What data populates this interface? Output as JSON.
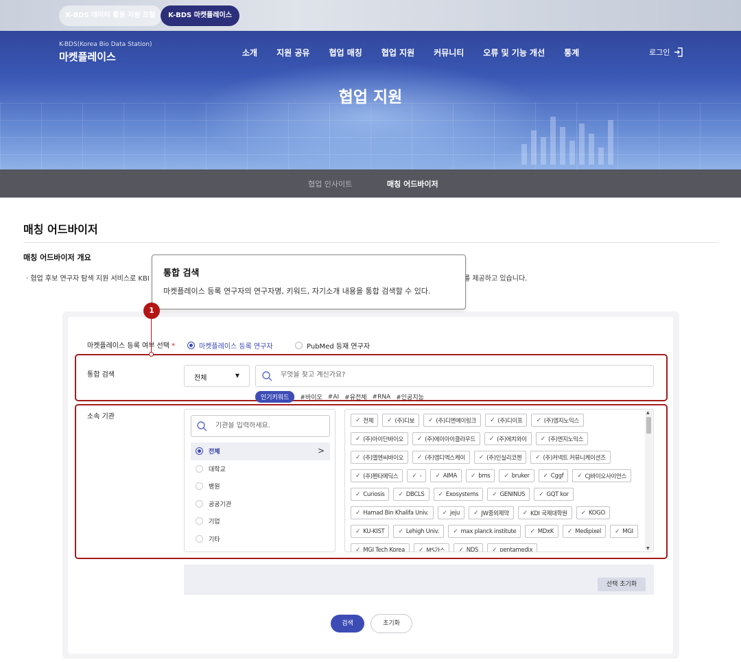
{
  "top_tabs": [
    "K-BDS 데이터 활용 지원 포털",
    "K-BDS 마켓플레이스"
  ],
  "brand": {
    "sub": "K-BDS(Korea Bio Data Station)",
    "main": "마켓플레이스"
  },
  "gnb": [
    "소개",
    "지원 공유",
    "협업 매칭",
    "협업 지원",
    "커뮤니티",
    "오류 및 기능 개선",
    "통계"
  ],
  "login_label": "로그인",
  "hero_title": "협업 지원",
  "subnav": [
    "협업 인사이트",
    "매칭 어드바이저"
  ],
  "page_title": "매칭 어드바이저",
  "section_title": "매칭 어드바이저 개요",
  "desc_left": "· 협업 후보 연구자 탐색 지원 서비스로 KBI",
  "desc_right": "를 제공하고 있습니다.",
  "tooltip": {
    "title": "통합 검색",
    "body": "마켓플레이스 등록 연구자의 연구자명, 키워드, 자기소개 내용을 통합 검색할 수 있다."
  },
  "marker_number": "1",
  "form": {
    "register_label": "마켓플레이스 등록 여부 선택",
    "required_mark": "*",
    "radio_options": [
      "마켓플레이스 등록 연구자",
      "PubMed 등재 연구자"
    ],
    "search_label": "통합 검색",
    "select_value": "전체",
    "search_placeholder": "무엇을 찾고 계신가요?",
    "popular_badge": "인기키워드",
    "keywords": [
      "#바이오",
      "#AI",
      "#유전체",
      "#RNA",
      "#인공지능"
    ],
    "org_label": "소속 기관",
    "org_placeholder": "기관을 입력하세요.",
    "org_types": [
      "전체",
      "대학교",
      "병원",
      "공공기관",
      "기업",
      "기타"
    ],
    "chips": [
      "전체",
      "(주)디보",
      "(주)디엔에이링크",
      "(주)디이프",
      "(주)엠지노믹스",
      "(주)아이단바이오",
      "(주)에이아이클라우드",
      "(주)에치와이",
      "(주)엔지노믹스",
      "(주)엘엔씨바이오",
      "(주)엠디엑스케이",
      "(주)인실리코젠",
      "(주)커넥트 커뮤니케이션즈",
      "(주)펜타메딕스",
      "-",
      "AIMA",
      "bms",
      "bruker",
      "Cggf",
      "CJ바이오사이언스",
      "Curiosis",
      "DBCLS",
      "Exosystems",
      "GENINUS",
      "GQT kor",
      "Hamad Bin Khalifa Univ.",
      "jeju",
      "JW중외제약",
      "KDI 국제대학원",
      "KOGO",
      "KU-KIST",
      "Lehigh Univ.",
      "max planck institute",
      "MDxK",
      "Medipixel",
      "MGI",
      "MGI Tech Korea",
      "MS가스",
      "NDS",
      "pentamedix"
    ],
    "reset_selection": "선택 초기화",
    "search_button": "검색",
    "reset_button": "초기화"
  }
}
